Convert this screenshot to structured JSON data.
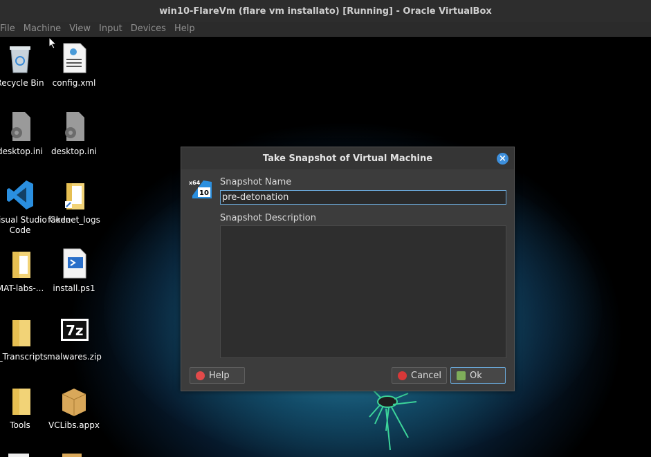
{
  "window": {
    "title": "win10-FlareVm (flare vm installato) [Running] - Oracle VirtualBox"
  },
  "menu": [
    "File",
    "Machine",
    "View",
    "Input",
    "Devices",
    "Help"
  ],
  "desktop_icons": [
    {
      "label": "Recycle Bin",
      "icon": "recycle-bin-icon"
    },
    {
      "label": "config.xml",
      "icon": "xml-file-icon"
    },
    {
      "label": "desktop.ini",
      "icon": "settings-file-icon"
    },
    {
      "label": "desktop.ini",
      "icon": "settings-file-icon"
    },
    {
      "label": "Visual Studio Code",
      "label2": "Code",
      "icon": "vscode-icon"
    },
    {
      "label": "fakenet_logs",
      "icon": "folder-shortcut-icon"
    },
    {
      "label": "MAT-labs-...",
      "icon": "folder-icon"
    },
    {
      "label": "install.ps1",
      "icon": "powershell-file-icon"
    },
    {
      "label": "S_Transcripts",
      "icon": "folder-icon"
    },
    {
      "label": "malwares.zip",
      "icon": "7zip-archive-icon"
    },
    {
      "label": "Tools",
      "icon": "folder-icon"
    },
    {
      "label": "VCLibs.appx",
      "icon": "package-icon"
    }
  ],
  "dialog": {
    "title": "Take Snapshot of Virtual Machine",
    "snapshot_icon_text": [
      "x64",
      "10"
    ],
    "name_label": "Snapshot Name",
    "name_value": "pre-detonation",
    "description_label": "Snapshot Description",
    "description_value": "",
    "help_button": "Help",
    "cancel_button": "Cancel",
    "ok_button": "Ok",
    "colors": {
      "close": "#3d8fdc",
      "focus": "#6aa8d8"
    }
  }
}
